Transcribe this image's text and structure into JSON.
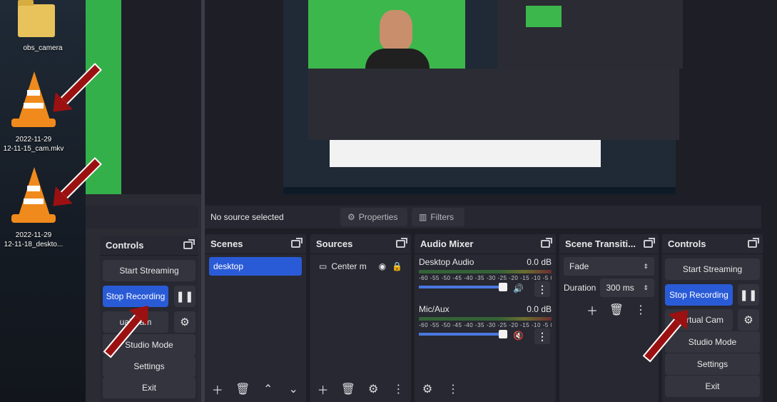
{
  "desktop": {
    "icons": [
      {
        "label": "obs_camera"
      },
      {
        "label_line1": "2022-11-29",
        "label_line2": "12-11-15_cam.mkv"
      },
      {
        "label_line1": "2022-11-29",
        "label_line2": "12-11-18_deskto..."
      }
    ]
  },
  "left_obs": {
    "controls_title": "Controls",
    "start_streaming": "Start Streaming",
    "stop_recording": "Stop Recording",
    "virtual_cam": "ual Cam",
    "studio_mode": "Studio Mode",
    "settings": "Settings",
    "exit": "Exit"
  },
  "status": {
    "no_source": "No source selected",
    "properties": "Properties",
    "filters": "Filters"
  },
  "scenes": {
    "title": "Scenes",
    "items": [
      "desktop"
    ]
  },
  "sources": {
    "title": "Sources",
    "items": [
      "Center m"
    ]
  },
  "audio_mixer": {
    "title": "Audio Mixer",
    "channels": [
      {
        "name": "Desktop Audio",
        "level": "0.0 dB",
        "volume": 0.85,
        "muted": false
      },
      {
        "name": "Mic/Aux",
        "level": "0.0 dB",
        "volume": 0.85,
        "muted": true
      }
    ],
    "scale": "-60 -55 -50 -45 -40 -35 -30 -25 -20 -15 -10 -5 0"
  },
  "transitions": {
    "title": "Scene Transiti...",
    "type": "Fade",
    "duration_label": "Duration",
    "duration_value": "300 ms"
  },
  "controls": {
    "title": "Controls",
    "start_streaming": "Start Streaming",
    "stop_recording": "Stop Recording",
    "virtual_cam": "t Virtual Cam",
    "studio_mode": "Studio Mode",
    "settings": "Settings",
    "exit": "Exit"
  },
  "colors": {
    "accent": "#2a5bd7",
    "arrow": "#9b1111",
    "muted": "#d02020"
  }
}
